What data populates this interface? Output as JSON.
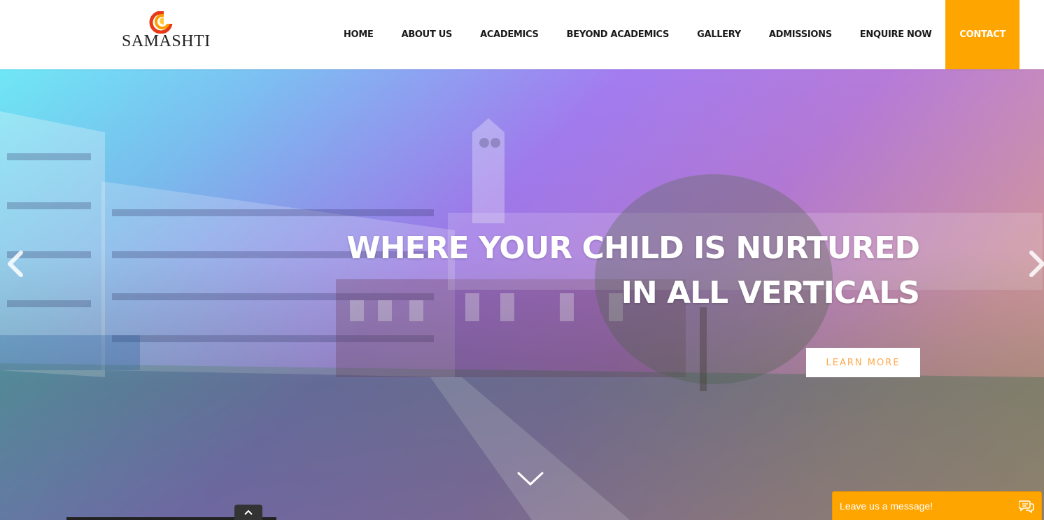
{
  "brand": {
    "name": "SAMASHTI"
  },
  "nav": {
    "items": [
      {
        "label": "HOME"
      },
      {
        "label": "ABOUT US"
      },
      {
        "label": "ACADEMICS"
      },
      {
        "label": "BEYOND ACADEMICS"
      },
      {
        "label": "GALLERY"
      },
      {
        "label": "ADMISSIONS"
      },
      {
        "label": "ENQUIRE NOW"
      },
      {
        "label": "CONTACT"
      }
    ]
  },
  "hero": {
    "headline_line1": "WHERE YOUR CHILD IS NURTURED",
    "headline_line2": "IN ALL VERTICALS",
    "cta_label": "LEARN MORE",
    "prev_icon": "chevron-left-icon",
    "next_icon": "chevron-right-icon",
    "scroll_icon": "chevron-down-icon"
  },
  "chat": {
    "label": "Leave us a message!",
    "icon": "chat-bubbles-icon"
  },
  "colors": {
    "accent": "#ffa500",
    "cta_text": "#ffa94d"
  }
}
